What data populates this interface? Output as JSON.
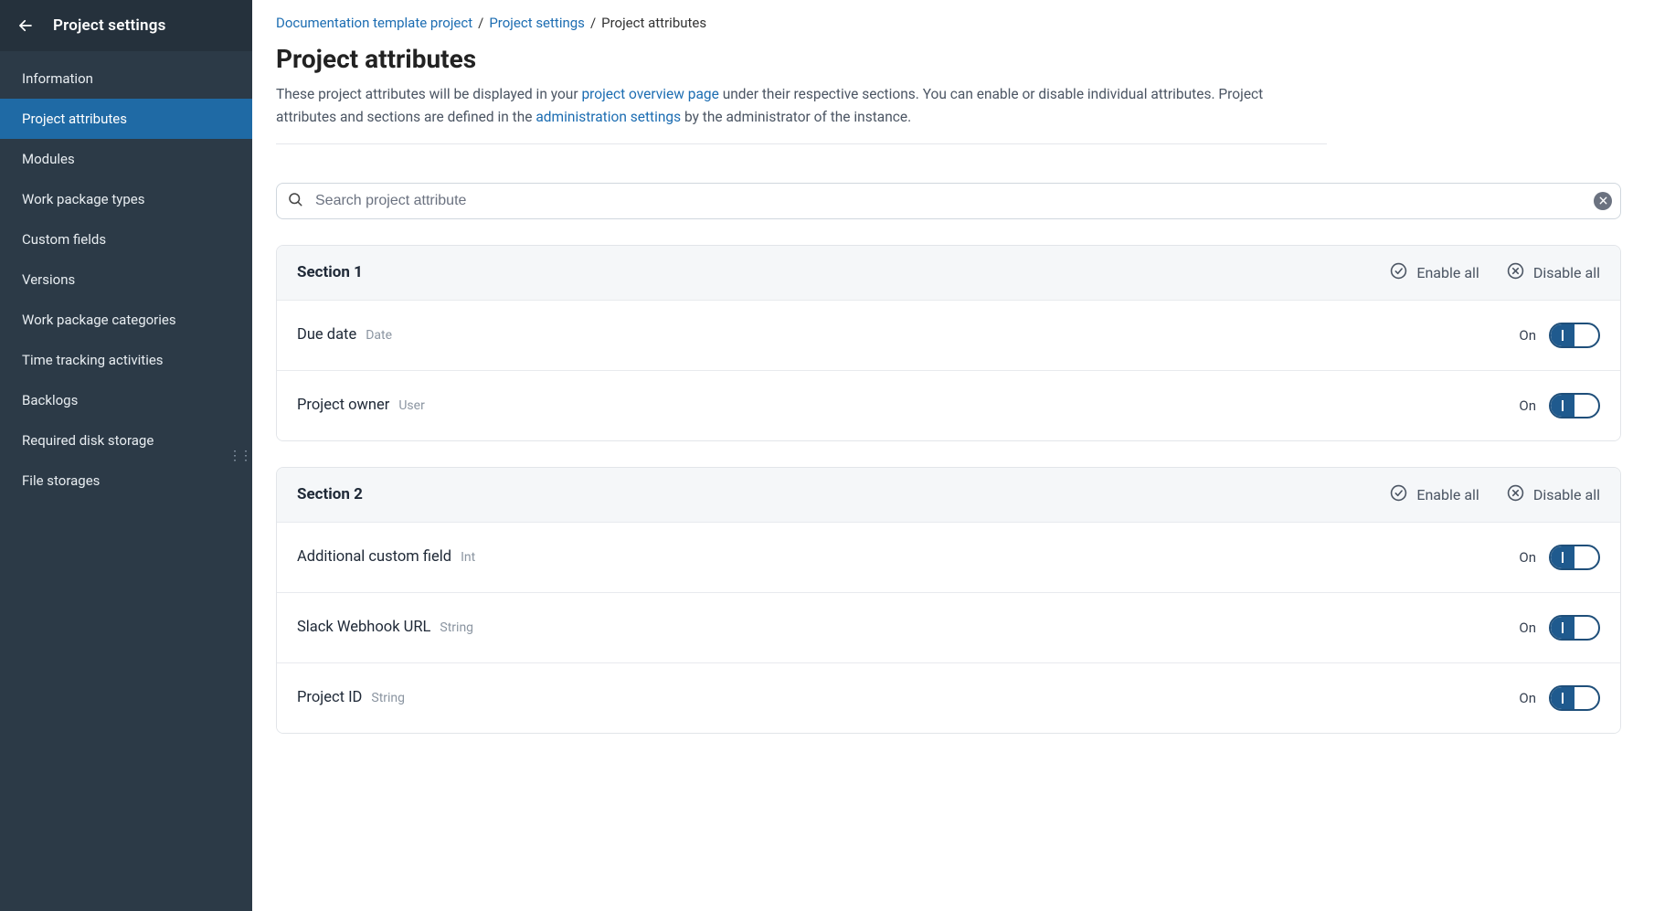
{
  "sidebar": {
    "title": "Project settings",
    "items": [
      {
        "label": "Information"
      },
      {
        "label": "Project attributes"
      },
      {
        "label": "Modules"
      },
      {
        "label": "Work package types"
      },
      {
        "label": "Custom fields"
      },
      {
        "label": "Versions"
      },
      {
        "label": "Work package categories"
      },
      {
        "label": "Time tracking activities"
      },
      {
        "label": "Backlogs"
      },
      {
        "label": "Required disk storage"
      },
      {
        "label": "File storages"
      }
    ],
    "active_index": 1
  },
  "breadcrumb": {
    "items": [
      {
        "label": "Documentation template project",
        "link": true
      },
      {
        "label": "Project settings",
        "link": true
      },
      {
        "label": "Project attributes",
        "link": false
      }
    ],
    "separator": "/"
  },
  "page": {
    "title": "Project attributes",
    "desc_parts": {
      "t1": "These project attributes will be displayed in your ",
      "link1": "project overview page",
      "t2": " under their respective sections. You can enable or disable individual attributes. Project attributes and sections are defined in the ",
      "link2": "administration settings",
      "t3": " by the administrator of the instance."
    }
  },
  "search": {
    "placeholder": "Search project attribute"
  },
  "section_actions": {
    "enable_all": "Enable all",
    "disable_all": "Disable all"
  },
  "toggle_state": "On",
  "sections": [
    {
      "title": "Section 1",
      "attrs": [
        {
          "name": "Due date",
          "type": "Date",
          "state": "On"
        },
        {
          "name": "Project owner",
          "type": "User",
          "state": "On"
        }
      ]
    },
    {
      "title": "Section 2",
      "attrs": [
        {
          "name": "Additional custom field",
          "type": "Int",
          "state": "On"
        },
        {
          "name": "Slack Webhook URL",
          "type": "String",
          "state": "On"
        },
        {
          "name": "Project ID",
          "type": "String",
          "state": "On"
        }
      ]
    }
  ]
}
